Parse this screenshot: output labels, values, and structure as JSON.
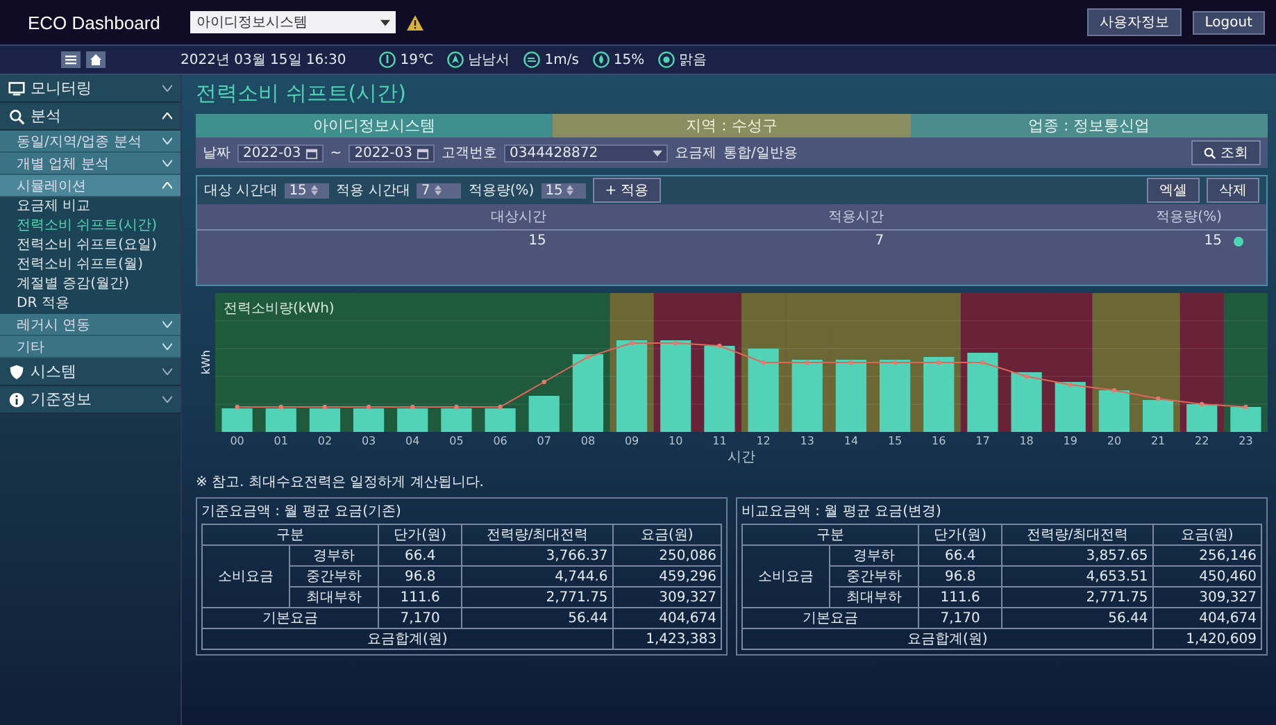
{
  "header": {
    "logo": "ECO Dashboard",
    "site_select": "아이디정보시스템",
    "buttons": [
      "사용자정보",
      "Logout"
    ]
  },
  "info_bar": {
    "datetime": "2022년 03월 15일 16:30",
    "weather": [
      {
        "kind": "temp",
        "text": "19℃"
      },
      {
        "kind": "direction",
        "text": "남남서"
      },
      {
        "kind": "wind",
        "text": "1m/s"
      },
      {
        "kind": "humidity",
        "text": "15%"
      },
      {
        "kind": "sky",
        "text": "맑음"
      }
    ]
  },
  "sidebar": {
    "items": [
      {
        "label": "모니터링",
        "expanded": false
      },
      {
        "label": "분석",
        "expanded": true,
        "children": [
          {
            "label": "동일/지역/업종 분석",
            "expanded": false
          },
          {
            "label": "개별 업체 분석",
            "expanded": false
          },
          {
            "label": "시뮬레이션",
            "expanded": true,
            "children": [
              {
                "label": "요금제 비교",
                "selected": false
              },
              {
                "label": "전력소비 쉬프트(시간)",
                "selected": true
              },
              {
                "label": "전력소비 쉬프트(요일)",
                "selected": false
              },
              {
                "label": "전력소비 쉬프트(월)",
                "selected": false
              },
              {
                "label": "계절별 증감(월간)",
                "selected": false
              },
              {
                "label": "DR 적용",
                "selected": false
              }
            ]
          },
          {
            "label": "레거시 연동",
            "expanded": false
          },
          {
            "label": "기타",
            "expanded": false
          }
        ]
      },
      {
        "label": "시스템",
        "expanded": false
      },
      {
        "label": "기준정보",
        "expanded": false
      }
    ]
  },
  "page_title": "전력소비 쉬프트(시간)",
  "banner": [
    {
      "kind": "company",
      "text": "아이디정보시스템"
    },
    {
      "kind": "region",
      "text": "지역 : 수성구"
    },
    {
      "kind": "industry",
      "text": "업종 : 정보통신업"
    }
  ],
  "filter": {
    "date_label": "날짜",
    "date_from": "2022-03",
    "range_separator": "~",
    "date_to": "2022-03",
    "customer_label": "고객번호",
    "customer": "0344428872",
    "plan_label": "요금제",
    "plan": "통합/일반용",
    "search_button": "조회"
  },
  "shift": {
    "target_label": "대상 시간대",
    "target": "15",
    "apply_label": "적용 시간대",
    "apply": "7",
    "ratio_label": "적용량(%)",
    "ratio": "15",
    "add_button": "+ 적용",
    "buttons": [
      "엑셀",
      "삭제"
    ],
    "columns": [
      "대상시간",
      "적용시간",
      "적용량(%)"
    ],
    "rows": [
      [
        "15",
        "7",
        "15"
      ]
    ]
  },
  "chart": {
    "legend": "전력소비량(kWh)",
    "ylabel": "kWh",
    "xlabel": "시간",
    "hours": [
      {
        "label": "00",
        "color": "#1f5a3c"
      },
      {
        "label": "01",
        "color": "#1f5a3c"
      },
      {
        "label": "02",
        "color": "#1f5a3c"
      },
      {
        "label": "03",
        "color": "#1f5a3c"
      },
      {
        "label": "04",
        "color": "#1f5a3c"
      },
      {
        "label": "05",
        "color": "#1f5a3c"
      },
      {
        "label": "06",
        "color": "#1f5a3c"
      },
      {
        "label": "07",
        "color": "#1f5a3c"
      },
      {
        "label": "08",
        "color": "#1f5a3c"
      },
      {
        "label": "09",
        "color": "#6b6836"
      },
      {
        "label": "10",
        "color": "#6a2238"
      },
      {
        "label": "11",
        "color": "#6a2238"
      },
      {
        "label": "12",
        "color": "#6b6836"
      },
      {
        "label": "13",
        "color": "#6b6836"
      },
      {
        "label": "14",
        "color": "#6b6836"
      },
      {
        "label": "15",
        "color": "#6b6836"
      },
      {
        "label": "16",
        "color": "#6b6836"
      },
      {
        "label": "17",
        "color": "#6a2238"
      },
      {
        "label": "18",
        "color": "#6a2238"
      },
      {
        "label": "19",
        "color": "#6a2238"
      },
      {
        "label": "20",
        "color": "#6b6836"
      },
      {
        "label": "21",
        "color": "#6b6836"
      },
      {
        "label": "22",
        "color": "#6a2238"
      },
      {
        "label": "23",
        "color": "#1f5a3c"
      }
    ]
  },
  "note": "※ 참고. 최대수요전력은 일정하게 계산됩니다.",
  "tables": [
    {
      "title": "기준요금액 : 월 평균 요금(기존)",
      "columns": [
        "구분",
        "단가(원)",
        "전력량/최대전력",
        "요금(원)"
      ],
      "usage_group": "소비요금",
      "rows": [
        {
          "kind": "usage",
          "label": "경부하",
          "price": "66.4",
          "amount": "3,766.37",
          "fee": "250,086"
        },
        {
          "kind": "usage",
          "label": "중간부하",
          "price": "96.8",
          "amount": "4,744.6",
          "fee": "459,296"
        },
        {
          "kind": "usage",
          "label": "최대부하",
          "price": "111.6",
          "amount": "2,771.75",
          "fee": "309,327"
        },
        {
          "kind": "base",
          "label": "기본요금",
          "price": "7,170",
          "amount": "56.44",
          "fee": "404,674"
        },
        {
          "kind": "total",
          "summary": "요금합계(원)",
          "fee": "1,423,383"
        }
      ]
    },
    {
      "title": "비교요금액 : 월 평균 요금(변경)",
      "columns": [
        "구분",
        "단가(원)",
        "전력량/최대전력",
        "요금(원)"
      ],
      "usage_group": "소비요금",
      "rows": [
        {
          "kind": "usage",
          "label": "경부하",
          "price": "66.4",
          "amount": "3,857.65",
          "fee": "256,146"
        },
        {
          "kind": "usage",
          "label": "중간부하",
          "price": "96.8",
          "amount": "4,653.51",
          "fee": "450,460"
        },
        {
          "kind": "usage",
          "label": "최대부하",
          "price": "111.6",
          "amount": "2,771.75",
          "fee": "309,327"
        },
        {
          "kind": "base",
          "label": "기본요금",
          "price": "7,170",
          "amount": "56.44",
          "fee": "404,674"
        },
        {
          "kind": "total",
          "summary": "요금합계(원)",
          "fee": "1,420,609"
        }
      ]
    }
  ]
}
